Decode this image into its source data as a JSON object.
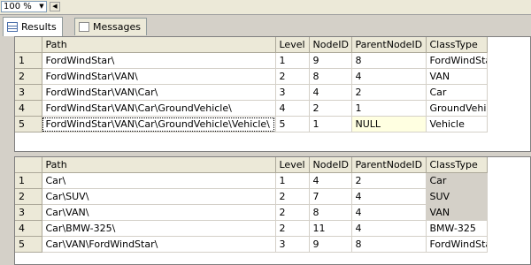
{
  "toolbar": {
    "zoom": "100 %"
  },
  "tabs": [
    {
      "label": "Results"
    },
    {
      "label": "Messages"
    }
  ],
  "grid1": {
    "columns": [
      "Path",
      "Level",
      "NodeID",
      "ParentNodeID",
      "ClassType"
    ],
    "rows": [
      {
        "num": "1",
        "cells": [
          "FordWindStar\\",
          "1",
          "9",
          "8",
          "FordWindStar"
        ]
      },
      {
        "num": "2",
        "cells": [
          "FordWindStar\\VAN\\",
          "2",
          "8",
          "4",
          "VAN"
        ]
      },
      {
        "num": "3",
        "cells": [
          "FordWindStar\\VAN\\Car\\",
          "3",
          "4",
          "2",
          "Car"
        ]
      },
      {
        "num": "4",
        "cells": [
          "FordWindStar\\VAN\\Car\\GroundVehicle\\",
          "4",
          "2",
          "1",
          "GroundVehicle"
        ]
      },
      {
        "num": "5",
        "cells": [
          "FordWindStar\\VAN\\Car\\GroundVehicle\\Vehicle\\",
          "5",
          "1",
          "NULL",
          "Vehicle"
        ]
      }
    ]
  },
  "grid2": {
    "columns": [
      "Path",
      "Level",
      "NodeID",
      "ParentNodeID",
      "ClassType"
    ],
    "rows": [
      {
        "num": "1",
        "cells": [
          "Car\\",
          "1",
          "4",
          "2",
          "Car"
        ]
      },
      {
        "num": "2",
        "cells": [
          "Car\\SUV\\",
          "2",
          "7",
          "4",
          "SUV"
        ]
      },
      {
        "num": "3",
        "cells": [
          "Car\\VAN\\",
          "2",
          "8",
          "4",
          "VAN"
        ]
      },
      {
        "num": "4",
        "cells": [
          "Car\\BMW-325\\",
          "2",
          "11",
          "4",
          "BMW-325"
        ]
      },
      {
        "num": "5",
        "cells": [
          "Car\\VAN\\FordWindStar\\",
          "3",
          "9",
          "8",
          "FordWindStar"
        ]
      }
    ]
  }
}
